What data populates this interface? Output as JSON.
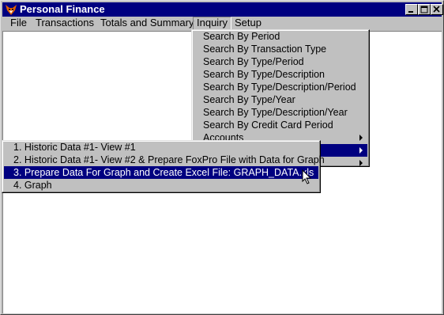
{
  "window": {
    "title": "Personal Finance"
  },
  "menubar": {
    "file": "File",
    "transactions": "Transactions",
    "totals": "Totals and Summary",
    "inquiry": "Inquiry",
    "setup": "Setup"
  },
  "inquiry_menu": {
    "items": [
      "Search By Period",
      "Search By Transaction Type",
      "Search By Type/Period",
      "Search By Type/Description",
      "Search By Type/Description/Period",
      "Search By Type/Year",
      "Search By Type/Description/Year",
      "Search By Credit Card Period",
      "Accounts"
    ]
  },
  "graph_submenu": {
    "items": [
      "1. Historic Data #1- View #1",
      "2. Historic Data #1- View #2  &  Prepare FoxPro File with Data for Graph",
      "3. Prepare Data For Graph and Create Excel File: GRAPH_DATA.xls",
      "4. Graph"
    ],
    "selected_index": 2
  },
  "colors": {
    "title_bar": "#000080",
    "selection": "#000080",
    "face": "#c0c0c0"
  },
  "icons": [
    "app-fox-icon",
    "minimize-icon",
    "maximize-icon",
    "close-icon",
    "submenu-arrow-icon",
    "mouse-cursor-icon"
  ]
}
